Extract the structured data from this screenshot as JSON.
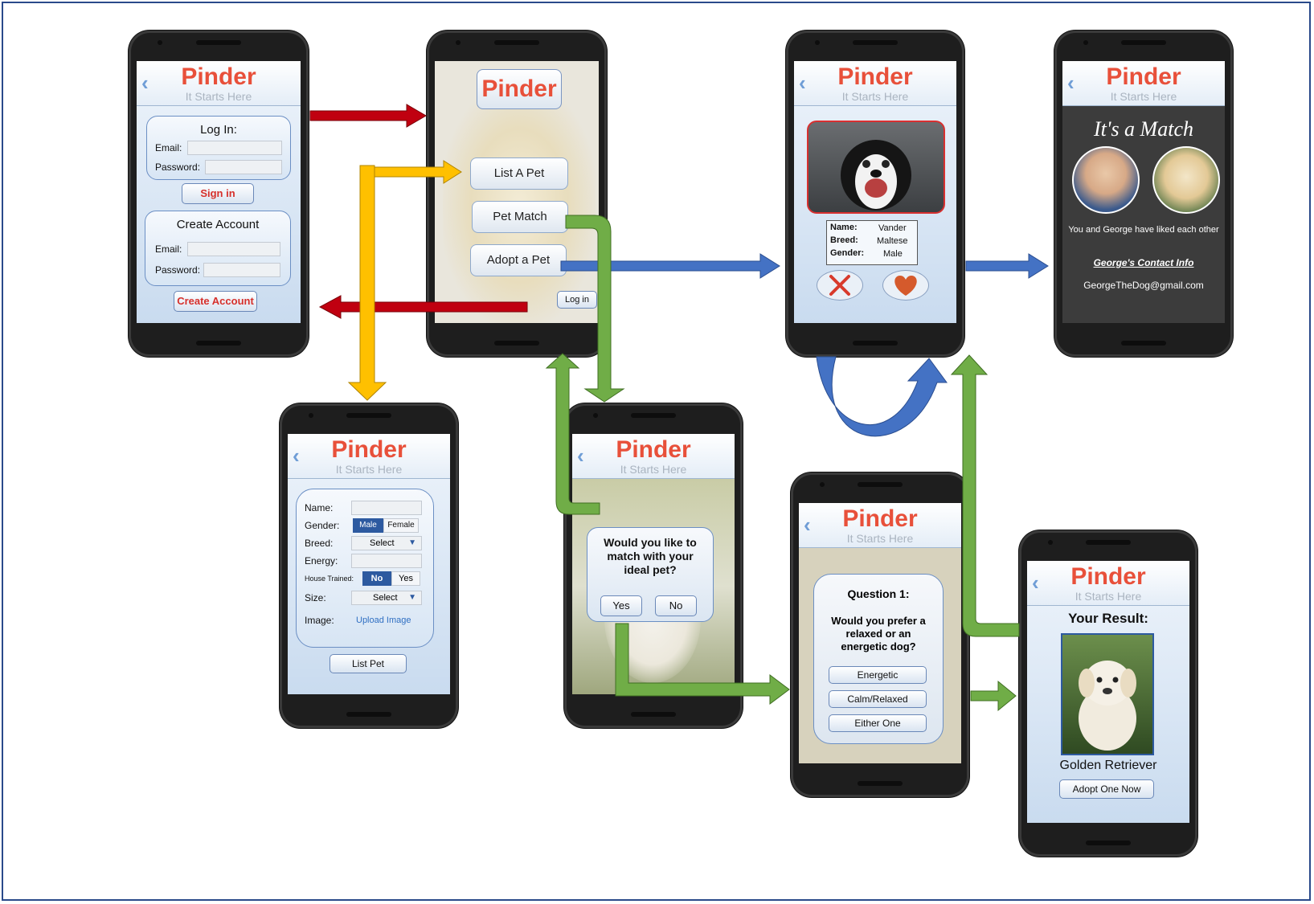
{
  "app": {
    "logo": "Pinder",
    "tagline": "It Starts Here"
  },
  "login_screen": {
    "login_title": "Log In:",
    "email_label": "Email:",
    "password_label": "Password:",
    "sign_in": "Sign in",
    "create_title": "Create Account",
    "create_email_label": "Email:",
    "create_password_label": "Password:",
    "create_button": "Create Account"
  },
  "home_screen": {
    "list_pet": "List A Pet",
    "pet_match": "Pet Match",
    "adopt_pet": "Adopt a Pet",
    "log_in": "Log in"
  },
  "swipe_screen": {
    "name_label": "Name:",
    "name_value": "Vander",
    "breed_label": "Breed:",
    "breed_value": "Maltese",
    "gender_label": "Gender:",
    "gender_value": "Male"
  },
  "match_screen": {
    "title": "It's a Match",
    "message": "You and George have liked each other",
    "contact_link": "George's Contact Info",
    "email": "GeorgeTheDog@gmail.com"
  },
  "list_screen": {
    "name_label": "Name:",
    "gender_label": "Gender:",
    "gender_male": "Male",
    "gender_female": "Female",
    "breed_label": "Breed:",
    "breed_select": "Select",
    "energy_label": "Energy:",
    "house_label": "House Trained:",
    "house_no": "No",
    "house_yes": "Yes",
    "size_label": "Size:",
    "size_select": "Select",
    "image_label": "Image:",
    "upload": "Upload Image",
    "list_button": "List Pet"
  },
  "match_prompt_screen": {
    "question": "Would you like to match with your ideal pet?",
    "yes": "Yes",
    "no": "No"
  },
  "quiz_screen": {
    "question_title": "Question 1:",
    "question_text": "Would you prefer a relaxed or an energetic dog?",
    "option1": "Energetic",
    "option2": "Calm/Relaxed",
    "option3": "Either One"
  },
  "result_screen": {
    "title": "Your Result:",
    "breed": "Golden Retriever",
    "adopt_button": "Adopt One Now"
  },
  "colors": {
    "red_arrow": "#c00010",
    "yellow_arrow": "#ffc000",
    "green_arrow": "#70ad47",
    "blue_arrow": "#4472c4",
    "logo": "#e8503a"
  }
}
